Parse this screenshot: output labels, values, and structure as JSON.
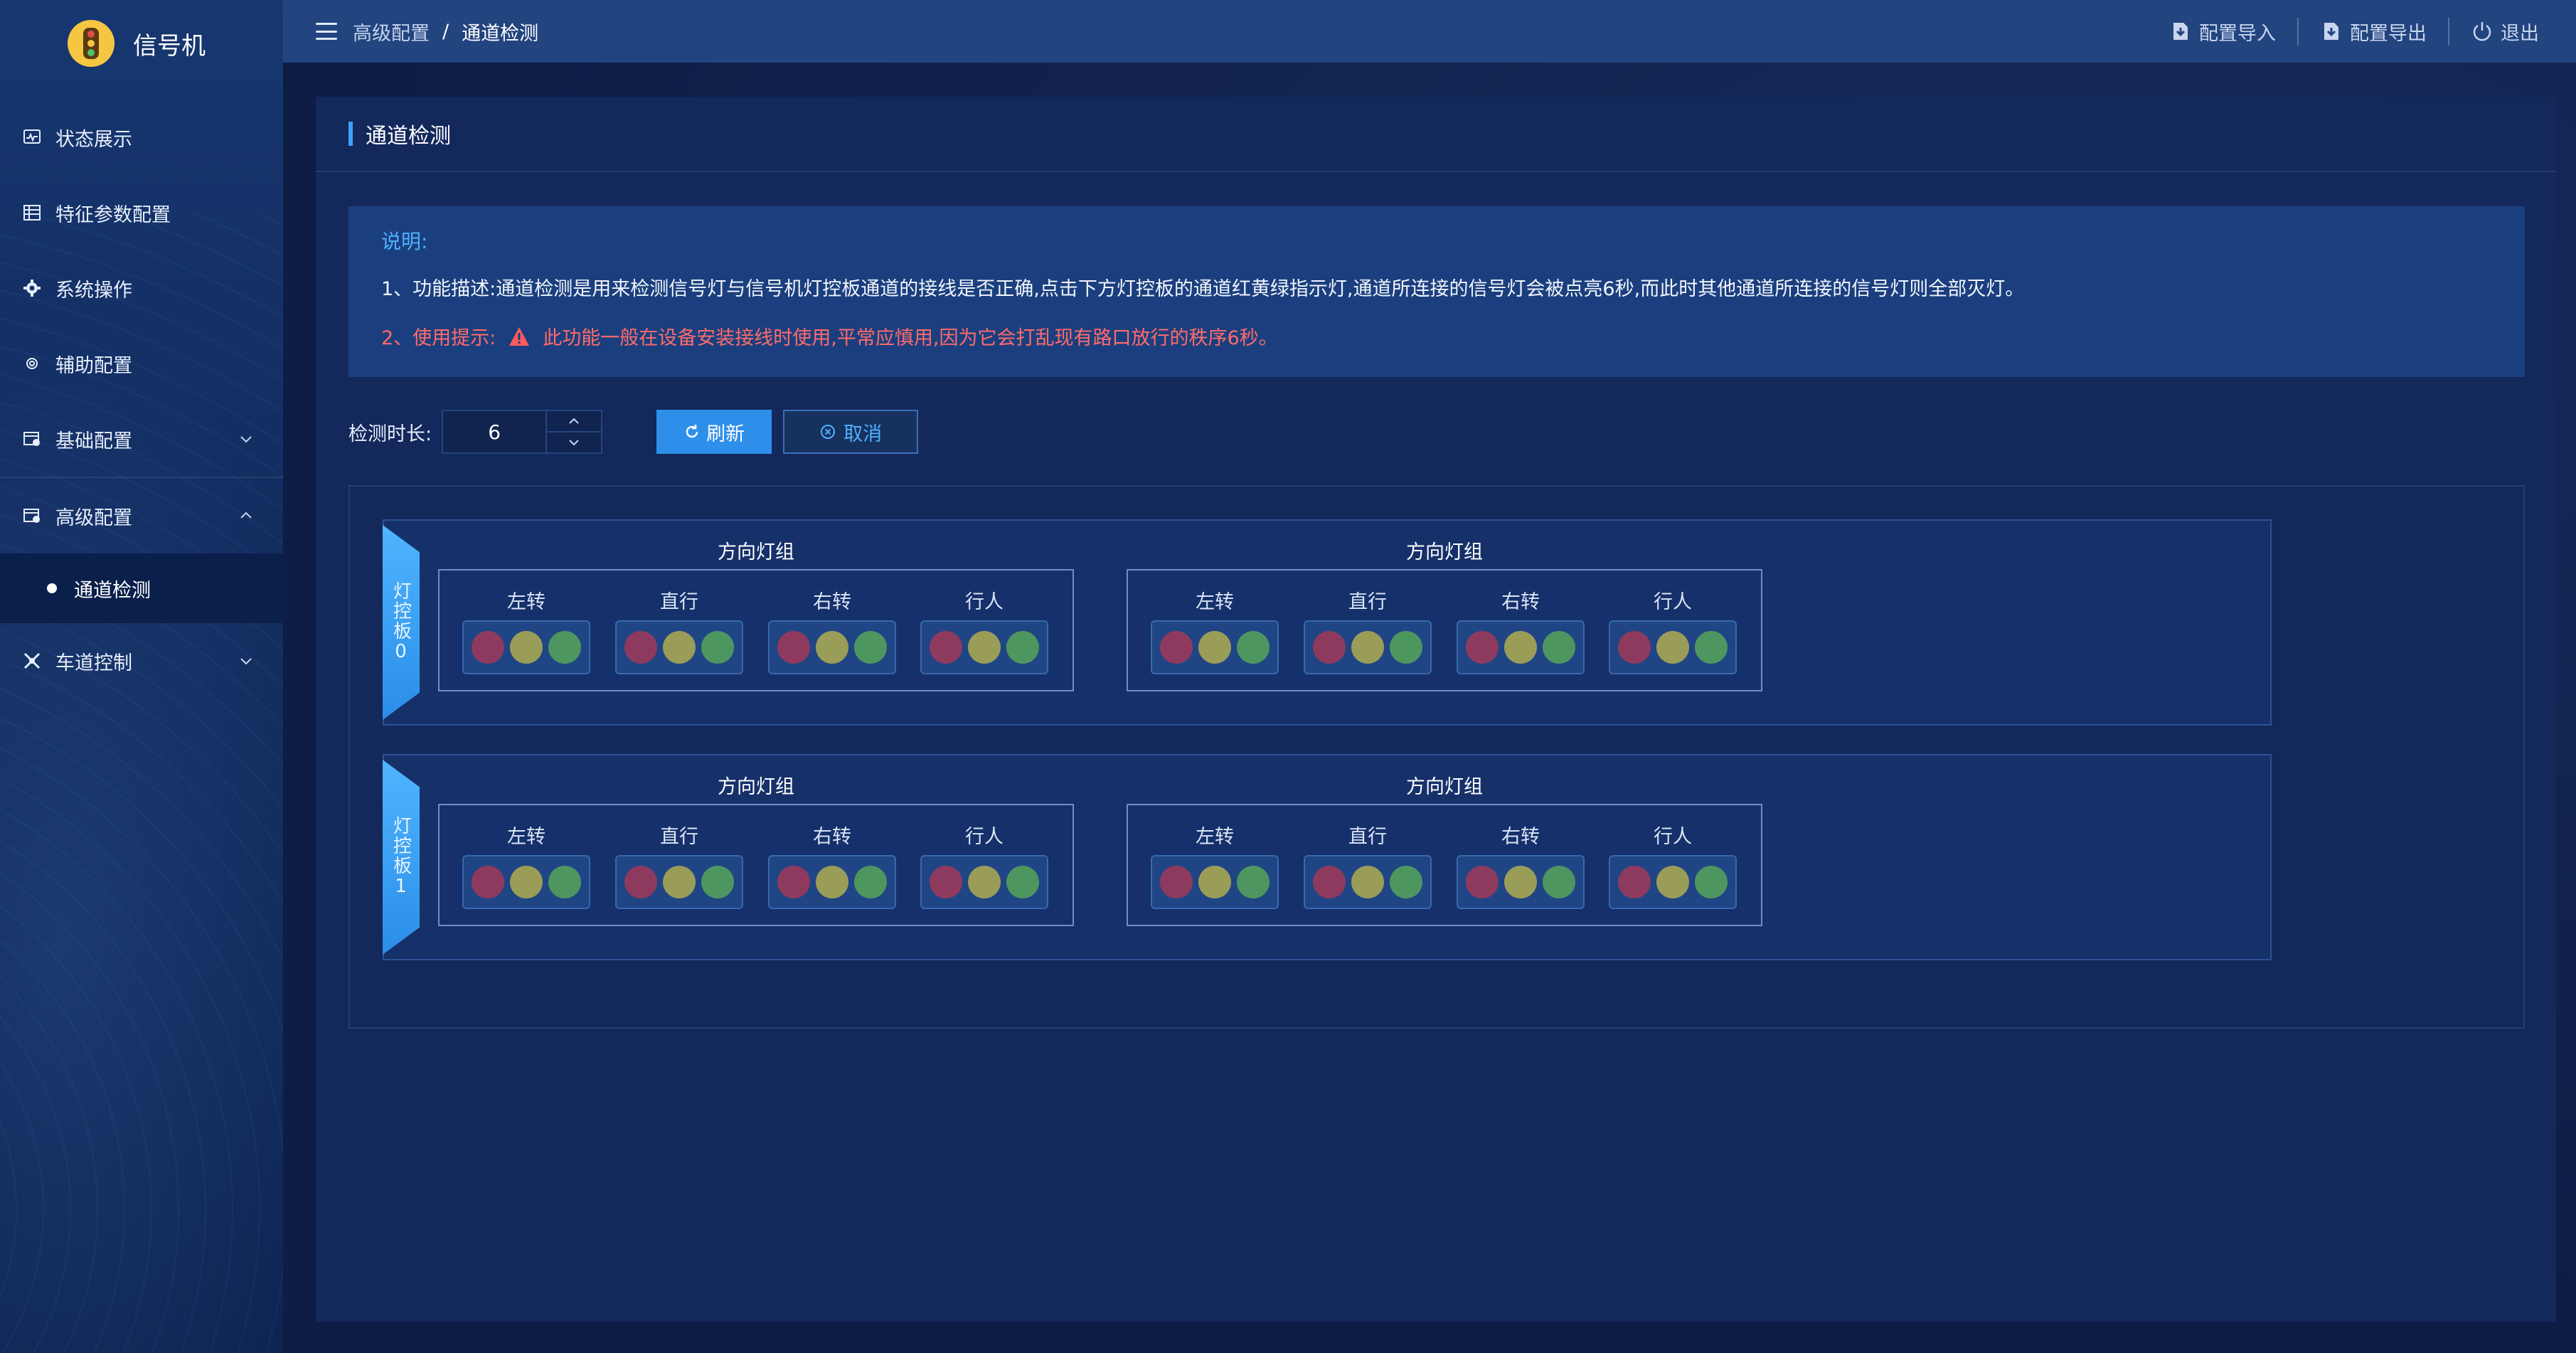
{
  "app": {
    "title": "信号机"
  },
  "sidebar": {
    "items": [
      {
        "label": "状态展示",
        "icon": "monitor-icon"
      },
      {
        "label": "特征参数配置",
        "icon": "table-icon"
      },
      {
        "label": "系统操作",
        "icon": "gear-icon"
      },
      {
        "label": "辅助配置",
        "icon": "cog-small-icon"
      },
      {
        "label": "基础配置",
        "icon": "config-icon",
        "expandable": true,
        "expanded": false
      },
      {
        "label": "高级配置",
        "icon": "config-icon",
        "expandable": true,
        "expanded": true
      },
      {
        "label": "车道控制",
        "icon": "lanes-icon",
        "expandable": true,
        "expanded": false
      }
    ],
    "submenu": {
      "label": "通道检测",
      "active": true
    }
  },
  "header": {
    "breadcrumb": [
      "高级配置",
      "通道检测"
    ],
    "separator": "/",
    "actions": [
      {
        "label": "配置导入",
        "icon": "import-icon"
      },
      {
        "label": "配置导出",
        "icon": "export-icon"
      },
      {
        "label": "退出",
        "icon": "power-icon"
      }
    ]
  },
  "panel": {
    "title": "通道检测",
    "notice": {
      "heading": "说明:",
      "line1": "1、功能描述:通道检测是用来检测信号灯与信号机灯控板通道的接线是否正确,点击下方灯控板的通道红黄绿指示灯,通道所连接的信号灯会被点亮6秒,而此时其他通道所连接的信号灯则全部灭灯。",
      "line2_prefix": "2、使用提示:",
      "line2_warning": "此功能一般在设备安装接线时使用,平常应慎用,因为它会打乱现有路口放行的秩序6秒。"
    },
    "controls": {
      "duration_label": "检测时长:",
      "duration_value": "6",
      "refresh_label": "刷新",
      "cancel_label": "取消"
    },
    "boards": [
      {
        "name": "灯控板0",
        "groups": [
          {
            "title": "方向灯组",
            "lanes": [
              "左转",
              "直行",
              "右转",
              "行人"
            ]
          },
          {
            "title": "方向灯组",
            "lanes": [
              "左转",
              "直行",
              "右转",
              "行人"
            ]
          }
        ]
      },
      {
        "name": "灯控板1",
        "groups": [
          {
            "title": "方向灯组",
            "lanes": [
              "左转",
              "直行",
              "右转",
              "行人"
            ]
          },
          {
            "title": "方向灯组",
            "lanes": [
              "左转",
              "直行",
              "右转",
              "行人"
            ]
          }
        ]
      }
    ]
  },
  "colors": {
    "accent": "#2e8fea",
    "notice_heading": "#4fb0ff",
    "warning": "#ff6b6b",
    "light_red": "#8e3a5e",
    "light_yellow": "#9a9d58",
    "light_green": "#4e9660"
  }
}
